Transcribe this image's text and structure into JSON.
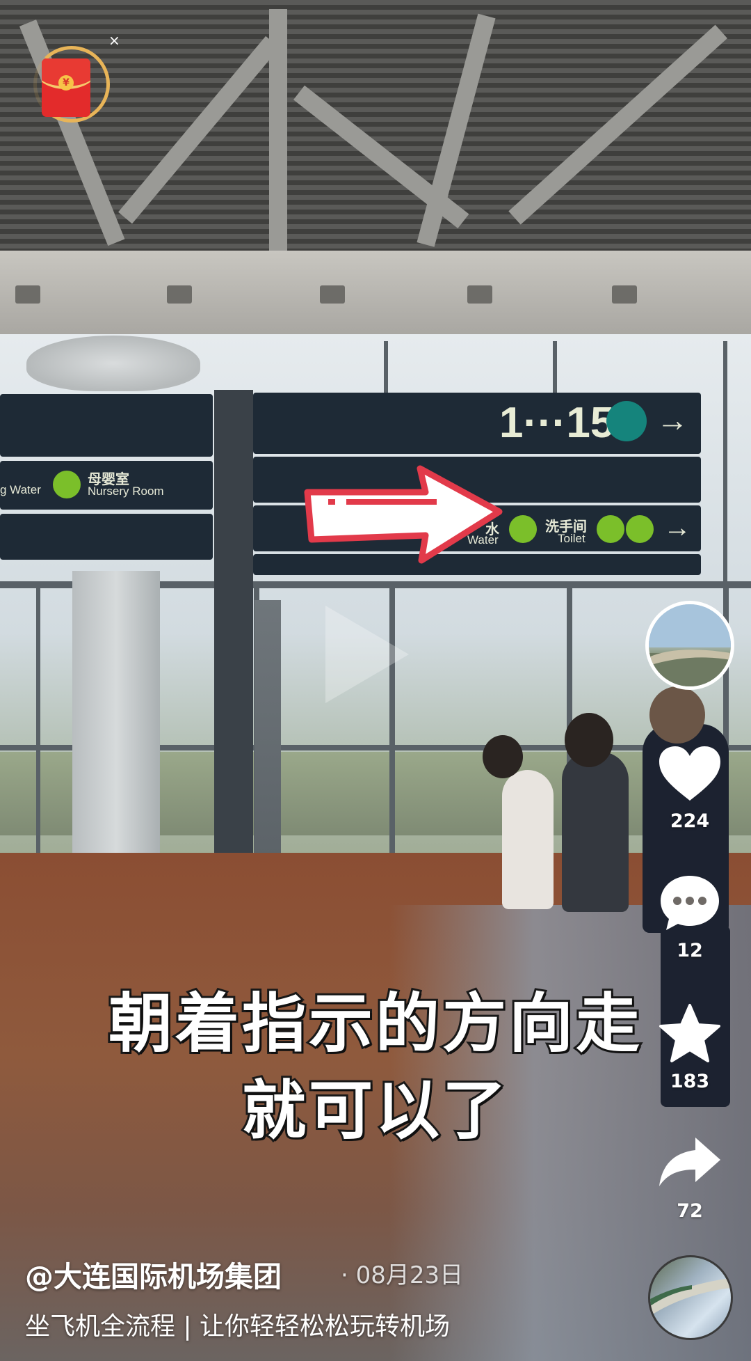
{
  "overlay": {
    "redpacket_icon": "red-envelope-icon",
    "close_symbol": "×"
  },
  "scene_signs": {
    "gate_range": "1···15",
    "nursery_cn": "母婴室",
    "nursery_en": "Nursery Room",
    "water_en_left": "g Water",
    "water_cn_right": "水",
    "water_en_right": "Water",
    "toilet_cn": "洗手间",
    "toilet_en": "Toilet",
    "arrow_glyph": "→"
  },
  "caption": {
    "line1": "朝着指示的方向走",
    "line2": "就可以了"
  },
  "rail": {
    "like_count": "224",
    "comment_count": "12",
    "favorite_count": "183",
    "share_count": "72"
  },
  "post": {
    "author": "@大连国际机场集团",
    "date": "· 08月23日",
    "description": "坐飞机全流程 | 让你轻轻松松玩转机场"
  },
  "colors": {
    "sign_bg": "#1e2a36",
    "sign_green": "#7bbf2a",
    "overlay_arrow_red": "#e23a4a"
  }
}
